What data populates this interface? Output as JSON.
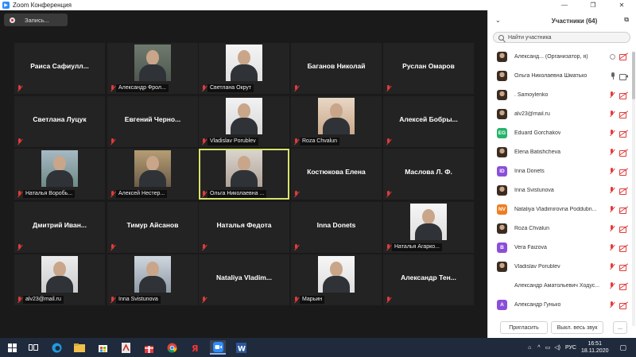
{
  "window": {
    "title": "Zoom Конференция",
    "controls": [
      "minimize-icon",
      "maximize-icon",
      "close-icon"
    ]
  },
  "record_button": {
    "label": "Запись..."
  },
  "tiles": [
    {
      "name": "Раиса  Сафиулл...",
      "type": "name"
    },
    {
      "label": "Александр Фрол...",
      "type": "video",
      "photo": "ph-a"
    },
    {
      "label": "Светлана Окрут",
      "type": "video",
      "photo": "ph-b"
    },
    {
      "name": "Баганов Николай",
      "type": "name"
    },
    {
      "name": "Руслан Омаров",
      "type": "name"
    },
    {
      "name": "Светлана Луцук",
      "type": "name"
    },
    {
      "name": "Евгений  Черно...",
      "type": "name"
    },
    {
      "label": "Vladislav Porublev",
      "type": "video",
      "photo": "ph-c"
    },
    {
      "label": "Roza Chvalun",
      "type": "video",
      "photo": "ph-d"
    },
    {
      "name": "Алексей  Бобры...",
      "type": "name"
    },
    {
      "label": "Наталья Воробь...",
      "type": "video",
      "photo": "ph-e"
    },
    {
      "label": "Алексей Нестер...",
      "type": "video",
      "photo": "ph-f"
    },
    {
      "label": "Ольга Николаевна ...",
      "type": "video",
      "photo": "ph-g",
      "active": true
    },
    {
      "name": "Костюкова Елена",
      "type": "name"
    },
    {
      "name": "Маслова Л. Ф.",
      "type": "name"
    },
    {
      "name": "Дмитрий  Иван...",
      "type": "name"
    },
    {
      "name": "Тимур Айсанов",
      "type": "name"
    },
    {
      "name": "Наталья Федота",
      "type": "name"
    },
    {
      "name": "Inna Donets",
      "type": "name"
    },
    {
      "label": "Наталья Агарко...",
      "type": "video",
      "photo": "ph-h"
    },
    {
      "label": "alv23@mail.ru",
      "type": "video",
      "photo": "ph-j"
    },
    {
      "label": "Inna Svistunova",
      "type": "video",
      "photo": "ph-i"
    },
    {
      "name": "Nataliya  Vladim...",
      "type": "name"
    },
    {
      "label": "Марьин",
      "type": "video",
      "photo": "ph-h"
    },
    {
      "name": "Александр  Тен...",
      "type": "name"
    }
  ],
  "sidebar": {
    "title": "Участники (64)",
    "search_placeholder": "Найти участника",
    "participants": [
      {
        "name": "Александ... (Организатор, я)",
        "avatar": "photo",
        "icons": [
          "circle",
          "video-off"
        ]
      },
      {
        "name": "Ольга Николаевна Шматько",
        "avatar": "photo",
        "icons": [
          "mic-on",
          "video-on"
        ]
      },
      {
        "name": ". Samoylenko",
        "avatar": "photo",
        "icons": [
          "mic-off",
          "video-off"
        ]
      },
      {
        "name": "alv23@mail.ru",
        "avatar": "photo",
        "icons": [
          "mic-off",
          "video-off"
        ]
      },
      {
        "name": "Eduard Gorchakov",
        "avatar": "EG",
        "color": "#26b36a",
        "icons": [
          "mic-off",
          "video-off"
        ]
      },
      {
        "name": "Elena Batishcheva",
        "avatar": "photo",
        "icons": [
          "mic-off",
          "video-off"
        ]
      },
      {
        "name": "Inna Donets",
        "avatar": "ID",
        "color": "#8a4fd8",
        "icons": [
          "mic-off",
          "video-off"
        ]
      },
      {
        "name": "Inna Svistunova",
        "avatar": "photo",
        "icons": [
          "mic-off",
          "video-off"
        ]
      },
      {
        "name": "Nataliya Vladimirovna Poddubn...",
        "avatar": "NV",
        "color": "#ef7d22",
        "icons": [
          "mic-off",
          "video-off"
        ]
      },
      {
        "name": "Roza Chvalun",
        "avatar": "photo",
        "icons": [
          "mic-off",
          "video-off"
        ]
      },
      {
        "name": "Vera Faizova",
        "avatar": "B",
        "color": "#8a4fd8",
        "icons": [
          "mic-off",
          "video-off"
        ]
      },
      {
        "name": "Vladislav Porublev",
        "avatar": "photo",
        "icons": [
          "mic-off",
          "video-off"
        ]
      },
      {
        "name": "Александр Аматольевич Ходус...",
        "avatar": "blank",
        "icons": [
          "mic-off",
          "video-off"
        ]
      },
      {
        "name": "Александр Гунько",
        "avatar": "A",
        "color": "#8a4fd8",
        "icons": [
          "mic-off",
          "video-off"
        ]
      }
    ],
    "footer": {
      "invite_label": "Пригласить",
      "mute_all_label": "Выкл. весь звук",
      "more_label": "..."
    }
  },
  "taskbar": {
    "time": "16:51",
    "date": "18.11.2020",
    "language": "РУС",
    "items": [
      "start-icon",
      "task-view-icon",
      "edge-icon",
      "file-explorer-icon",
      "store-icon",
      "acrobat-icon",
      "gift-app-icon",
      "chrome-icon",
      "yandex-icon",
      "zoom-icon",
      "word-icon"
    ]
  }
}
